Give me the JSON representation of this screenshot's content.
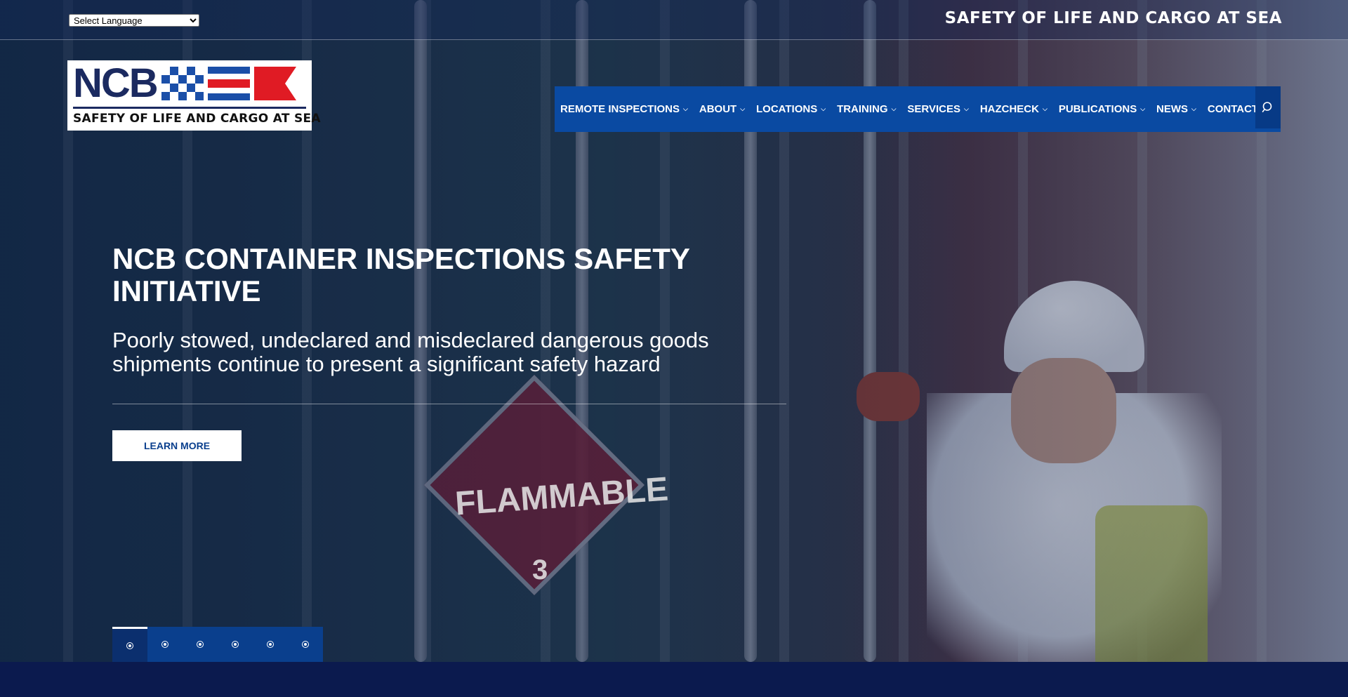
{
  "topbar": {
    "language_select": {
      "selected": "Select Language"
    },
    "tagline": "SAFETY OF LIFE AND CARGO AT SEA"
  },
  "logo": {
    "letters": "NCB",
    "subtitle": "SAFETY OF LIFE AND CARGO AT SEA"
  },
  "nav": {
    "items": [
      {
        "label": "REMOTE INSPECTIONS",
        "has_dropdown": true
      },
      {
        "label": "ABOUT",
        "has_dropdown": true
      },
      {
        "label": "LOCATIONS",
        "has_dropdown": true
      },
      {
        "label": "TRAINING",
        "has_dropdown": true
      },
      {
        "label": "SERVICES",
        "has_dropdown": true
      },
      {
        "label": "HAZCHECK",
        "has_dropdown": true
      },
      {
        "label": "PUBLICATIONS",
        "has_dropdown": true
      },
      {
        "label": "NEWS",
        "has_dropdown": true
      },
      {
        "label": "CONTACT",
        "has_dropdown": false
      }
    ],
    "search_icon": "search-icon",
    "chevron_icon": "chevron-down-icon"
  },
  "hero": {
    "title": "NCB CONTAINER INSPECTIONS SAFETY INITIATIVE",
    "subtitle": "Poorly stowed, undeclared and misdeclared dangerous goods shipments continue to present a significant safety hazard",
    "cta_label": "LEARN MORE",
    "image_placard_text": "FLAMMABLE",
    "image_placard_number": "3"
  },
  "slider": {
    "slide_count": 6,
    "active_index": 0
  },
  "colors": {
    "nav_blue": "#0a4aa2",
    "dots_blue": "#0a3f8d",
    "brand_navy": "#1b2a60",
    "footer_navy": "#0b1a4e"
  }
}
